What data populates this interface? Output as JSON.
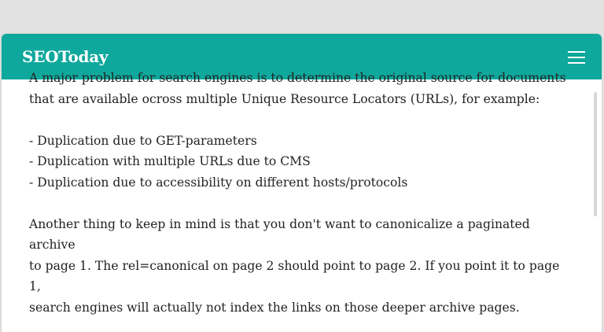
{
  "header": {
    "logo": "SEOToday",
    "menu_icon": "hamburger-menu-icon"
  },
  "article": {
    "intro": [
      "A major problem for search engines is to determine the original source for documents",
      "that are available ocross multiple Unique Resource Locators (URLs), for example:"
    ],
    "list": [
      "- Duplication due to GET-parameters",
      "- Duplication with multiple URLs due to CMS",
      "- Duplication due to accessibility on different hosts/protocols"
    ],
    "outro": [
      "Another thing to keep in mind is that you don't want to canonicalize a paginated archive",
      "to page 1. The rel=canonical on page 2 should point to page 2. If you point it to page 1,",
      "search engines will actually not index the links on those deeper archive pages."
    ]
  },
  "colors": {
    "brand": "#0ea89c",
    "text": "#222222",
    "background": "#e2e2e2"
  }
}
